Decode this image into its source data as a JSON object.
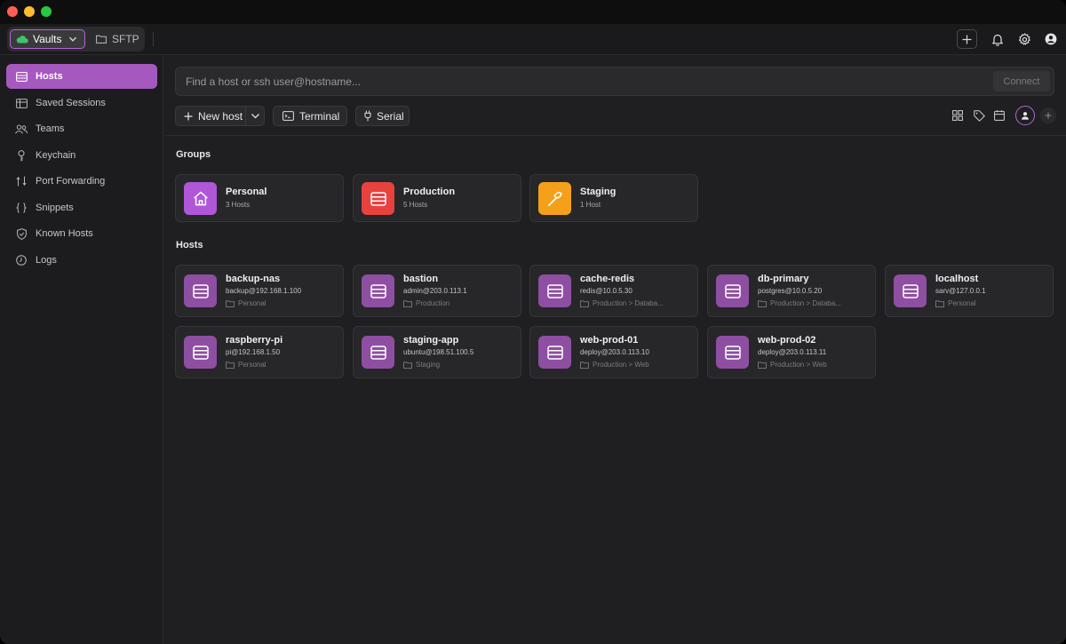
{
  "tabs": {
    "vaults_label": "Vaults",
    "sftp_label": "SFTP"
  },
  "sidebar": {
    "items": [
      {
        "label": "Hosts",
        "icon": "hosts-icon",
        "active": true
      },
      {
        "label": "Saved Sessions",
        "icon": "saved-sessions-icon"
      },
      {
        "label": "Teams",
        "icon": "teams-icon"
      },
      {
        "label": "Keychain",
        "icon": "keychain-icon"
      },
      {
        "label": "Port Forwarding",
        "icon": "port-forwarding-icon"
      },
      {
        "label": "Snippets",
        "icon": "snippets-icon"
      },
      {
        "label": "Known Hosts",
        "icon": "known-hosts-icon"
      },
      {
        "label": "Logs",
        "icon": "logs-icon"
      }
    ]
  },
  "search": {
    "placeholder": "Find a host or ssh user@hostname...",
    "value": "",
    "connect_label": "Connect"
  },
  "toolbar": {
    "new_host_label": "New host",
    "terminal_label": "Terminal",
    "serial_label": "Serial"
  },
  "groups": {
    "title": "Groups",
    "items": [
      {
        "name": "Personal",
        "count": "3 Hosts",
        "color": "#b056d8",
        "icon": "home-icon"
      },
      {
        "name": "Production",
        "count": "5 Hosts",
        "color": "#e8423f",
        "icon": "server-icon"
      },
      {
        "name": "Staging",
        "count": "1 Host",
        "color": "#f5a01a",
        "icon": "hammer-icon"
      }
    ]
  },
  "hosts": {
    "title": "Hosts",
    "items": [
      {
        "name": "backup-nas",
        "address": "backup@192.168.1.100",
        "group": "Personal"
      },
      {
        "name": "bastion",
        "address": "admin@203.0.113.1",
        "group": "Production"
      },
      {
        "name": "cache-redis",
        "address": "redis@10.0.5.30",
        "group": "Production > Databa..."
      },
      {
        "name": "db-primary",
        "address": "postgres@10.0.5.20",
        "group": "Production > Databa..."
      },
      {
        "name": "localhost",
        "address": "sarv@127.0.0.1",
        "group": "Personal"
      },
      {
        "name": "raspberry-pi",
        "address": "pi@192.168.1.50",
        "group": "Personal"
      },
      {
        "name": "staging-app",
        "address": "ubuntu@198.51.100.5",
        "group": "Staging"
      },
      {
        "name": "web-prod-01",
        "address": "deploy@203.0.113.10",
        "group": "Production > Web"
      },
      {
        "name": "web-prod-02",
        "address": "deploy@203.0.113.11",
        "group": "Production > Web"
      }
    ]
  },
  "colors": {
    "accent": "#a559bf",
    "host_tile": "#8e4fa2"
  }
}
